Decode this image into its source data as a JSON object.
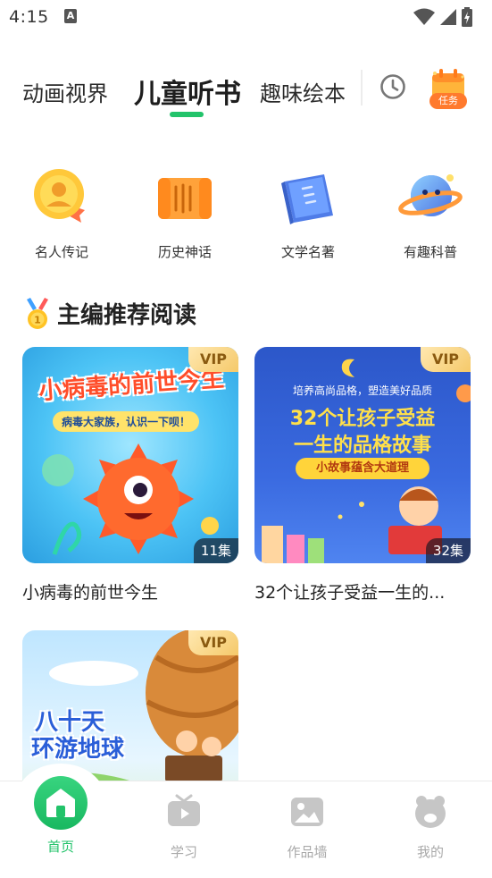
{
  "status": {
    "time": "4:15",
    "notification_glyph": "A"
  },
  "tabs": [
    {
      "label": "动画视界",
      "active": false
    },
    {
      "label": "儿童听书",
      "active": true
    },
    {
      "label": "趣味绘本",
      "active": false
    }
  ],
  "header": {
    "history_icon": "clock-icon",
    "task_label": "任务"
  },
  "categories": [
    {
      "label": "名人传记",
      "icon": "medal-person-icon"
    },
    {
      "label": "历史神话",
      "icon": "scroll-icon"
    },
    {
      "label": "文学名著",
      "icon": "book-icon"
    },
    {
      "label": "有趣科普",
      "icon": "planet-icon"
    }
  ],
  "section": {
    "title": "主编推荐阅读"
  },
  "cards": [
    {
      "title": "小病毒的前世今生",
      "vip": "VIP",
      "episodes": "11集",
      "cover_title": "小病毒的前世今生",
      "cover_subtitle": "病毒大家族，认识一下呗！"
    },
    {
      "title": "32个让孩子受益一生的...",
      "vip": "VIP",
      "episodes": "32集",
      "cover_tagline": "培养高尚品格，塑造美好品质",
      "cover_title_line1": "32个让孩子受益",
      "cover_title_line2": "一生的品格故事",
      "cover_subtitle": "小故事蕴含大道理"
    },
    {
      "title": "",
      "vip": "VIP",
      "cover_title_line1": "八十天",
      "cover_title_line2": "环游地球"
    }
  ],
  "bottom_nav": [
    {
      "label": "首页",
      "active": true
    },
    {
      "label": "学习",
      "active": false
    },
    {
      "label": "作品墙",
      "active": false
    },
    {
      "label": "我的",
      "active": false
    }
  ],
  "colors": {
    "accent": "#22c36a",
    "inactive": "#a9a9a9"
  }
}
